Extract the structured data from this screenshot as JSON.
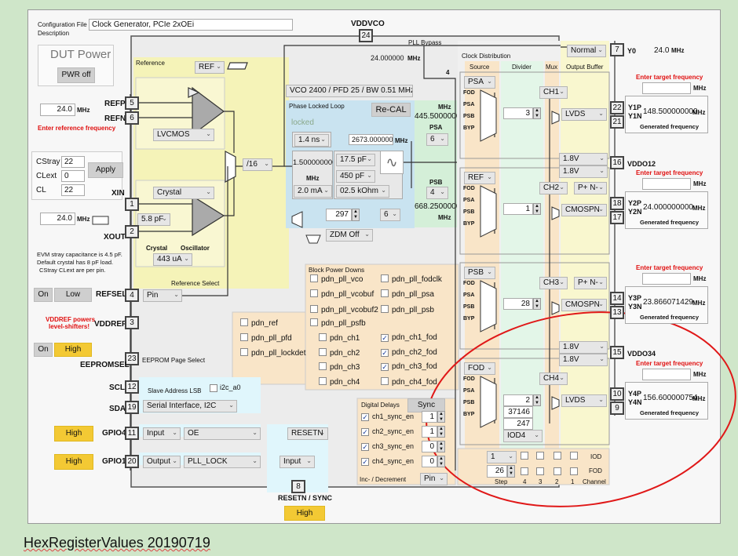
{
  "header": {
    "config_label_1": "Configuration File",
    "config_label_2": "Description",
    "config_value": "Clock Generator, PCIe 2xOEi",
    "vddvco": "VDDVCO",
    "vddvco_pin": "24"
  },
  "dut": {
    "title": "DUT Power",
    "button": "PWR off"
  },
  "reference": {
    "freq": "24.0",
    "unit": "MHz",
    "hint": "Enter reference frequency",
    "refp": "REFP",
    "refp_pin": "5",
    "refn": "REFN",
    "refn_pin": "6",
    "panel": "Reference",
    "ref_select": "REF",
    "input_type": "LVCMOS",
    "divider": "/16",
    "crystal": "Crystal",
    "crystal_cap": "5.8 pF",
    "crystal_lbl": "Crystal",
    "osc_lbl": "Oscillator",
    "current": "443 uA",
    "select_label": "Reference Select"
  },
  "caps": {
    "cstray_label": "CStray",
    "cstray": "22",
    "clext_label": "CLext",
    "clext": "0",
    "cl_label": "CL",
    "cl": "22",
    "apply": "Apply"
  },
  "xtal": {
    "xin": "XIN",
    "xin_pin": "1",
    "xout": "XOUT",
    "xout_pin": "2",
    "freq": "24.0",
    "unit": "MHz",
    "note": [
      "EVM stray capacitance is 4.5 pF.",
      "Default crystal has 8 pF load.",
      "CStray CLext are per pin."
    ]
  },
  "pins": {
    "on": "On",
    "low": "Low",
    "refsel": "REFSEL",
    "refsel_pin": "4",
    "refsel_value": "Pin",
    "vddref_warn": [
      "VDDREF powers",
      "level-shifters!"
    ],
    "vddref": "VDDREF",
    "vddref_pin": "3",
    "on2": "On",
    "high": "High",
    "eepromsel": "EEPROMSEL",
    "eeprom_pin": "23",
    "eeprom_desc": "EEPROM Page Select",
    "scl": "SCL",
    "scl_pin": "12",
    "sda": "SDA",
    "sda_pin": "19",
    "slave_lbl": "Slave Address LSB",
    "i2c_a0": "i2c_a0",
    "serial": "Serial Interface, I2C",
    "gpio4_state": "High",
    "gpio4": "GPIO4",
    "gpio4_pin": "11",
    "gpio4_dir": "Input",
    "gpio4_fn": "OE",
    "gpio1_state": "High",
    "gpio1": "GPIO1",
    "gpio1_pin": "20",
    "gpio1_dir": "Output",
    "gpio1_fn": "PLL_LOCK",
    "resetn_fn": "RESETN",
    "resetn_dir": "Input",
    "resetn_pin": "8",
    "resetn": "RESETN / SYNC",
    "resetn_state": "High"
  },
  "pll": {
    "bypass": "PLL Bypass",
    "bypass_freq": "24.000000",
    "mhz": "MHz",
    "four": "4",
    "vco": "VCO 2400 / PFD 25 / BW 0.51 MHz",
    "title": "Phase Locked Loop",
    "recal": "Re-CAL",
    "status": "locked",
    "delay": "1.4 ns",
    "vco_freq": "2673.0000000",
    "pfd_freq": "1.500000000",
    "c1": "17.5 pF",
    "c2": "450 pF",
    "cp": "2.0 mA",
    "r": "02.5 kOhm",
    "fb_div": "297",
    "fb_pre": "6",
    "zdm": "ZDM Off",
    "psa_freq": "445.5000000",
    "psa": "PSA",
    "psa_div": "6",
    "psb": "PSB",
    "psb_div": "4",
    "psb_freq": "668.2500000",
    "status_color": "#8aa88a"
  },
  "dist": {
    "title": "Clock Distribution",
    "col_source": "Source",
    "col_divider": "Divider",
    "col_mux": "Mux",
    "col_buffer": "Output Buffer",
    "y0_mode": "Normal",
    "y0_pin": "7",
    "y0": "Y0",
    "y0_freq": "24.0",
    "mux_inputs": [
      "FOD",
      "PSA",
      "PSB",
      "BYP"
    ],
    "target_hint": "Enter target frequency",
    "gen_label": "Generated frequency",
    "vddo12": "VDDO12",
    "vddo12_pin": "16",
    "vddo34": "VDDO34",
    "vddo34_pin": "15",
    "v18": "1.8V",
    "channels": [
      {
        "source": "PSA",
        "div": "3",
        "ch": "CH1",
        "format": "LVDS",
        "pins": [
          "22",
          "21"
        ],
        "names": [
          "Y1P",
          "Y1N"
        ],
        "freq": "148.500000000",
        "target": ""
      },
      {
        "source": "REF",
        "div": "1",
        "ch": "CH2",
        "pol": "P+ N-",
        "format": "CMOSPN",
        "pins": [
          "18",
          "17"
        ],
        "names": [
          "Y2P",
          "Y2N"
        ],
        "freq": "24.000000000",
        "target": ""
      },
      {
        "source": "PSB",
        "div": "28",
        "ch": "CH3",
        "pol": "P+ N-",
        "format": "CMOSPN",
        "pins": [
          "14",
          "13"
        ],
        "names": [
          "Y3P",
          "Y3N"
        ],
        "freq": "23.866071429",
        "target": ""
      },
      {
        "source": "FOD",
        "div": "2",
        "fod_a": "37146",
        "fod_b": "247",
        "iod": "IOD4",
        "ch": "CH4",
        "format": "LVDS",
        "pins": [
          "10",
          "9"
        ],
        "names": [
          "Y4P",
          "Y4N"
        ],
        "freq": "156.600000754",
        "target": ""
      }
    ],
    "step_sel": "1",
    "step": "26",
    "iod": "IOD",
    "fod": "FOD",
    "step_lbl": "Step",
    "ch_nums": [
      "4",
      "3",
      "2",
      "1"
    ],
    "channel_lbl": "Channel"
  },
  "pdn": {
    "title": "Block Power Downs",
    "items": [
      {
        "label": "pdn_pll_vco",
        "checked": false
      },
      {
        "label": "pdn_pll_fodclk",
        "checked": false
      },
      {
        "label": "pdn_pll_vcobuf",
        "checked": false
      },
      {
        "label": "pdn_pll_psa",
        "checked": false
      },
      {
        "label": "pdn_pll_vcobuf2",
        "checked": false
      },
      {
        "label": "pdn_pll_psb",
        "checked": false
      },
      {
        "label": "pdn_ref",
        "checked": false
      },
      {
        "label": "pdn_pll_psfb",
        "checked": false
      },
      {
        "label": "pdn_pll_pfd",
        "checked": false
      },
      {
        "label": "pdn_ch1",
        "checked": false
      },
      {
        "label": "pdn_ch1_fod",
        "checked": true
      },
      {
        "label": "pdn_pll_lockdet",
        "checked": false
      },
      {
        "label": "pdn_ch2",
        "checked": false
      },
      {
        "label": "pdn_ch2_fod",
        "checked": true
      },
      {
        "label": "pdn_ch3",
        "checked": false
      },
      {
        "label": "pdn_ch3_fod",
        "checked": true
      },
      {
        "label": "pdn_ch4",
        "checked": false
      },
      {
        "label": "pdn_ch4_fod",
        "checked": false
      }
    ]
  },
  "delays": {
    "title": "Digital Delays",
    "sync": "Sync",
    "items": [
      {
        "label": "ch1_sync_en",
        "checked": true,
        "value": "1"
      },
      {
        "label": "ch2_sync_en",
        "checked": true,
        "value": "1"
      },
      {
        "label": "ch3_sync_en",
        "checked": true,
        "value": "0"
      },
      {
        "label": "ch4_sync_en",
        "checked": true,
        "value": "0"
      }
    ],
    "incdec": "Inc- / Decrement",
    "incdec_src": "Pin"
  },
  "footer": "HexRegisterValues 20190719",
  "colors": {
    "background": "#cfe6c9",
    "reference_panel": "#f5f3b8",
    "pll_panel": "#c9e3f0",
    "postscaler_panel": "#d4efd8",
    "source_col": "#f9e5c8",
    "divider_col": "#e3f6e8",
    "buffer_col": "#f9f7cf",
    "high_button": "#f3c934",
    "annotation": "#e01010",
    "hint": "#e01010"
  }
}
